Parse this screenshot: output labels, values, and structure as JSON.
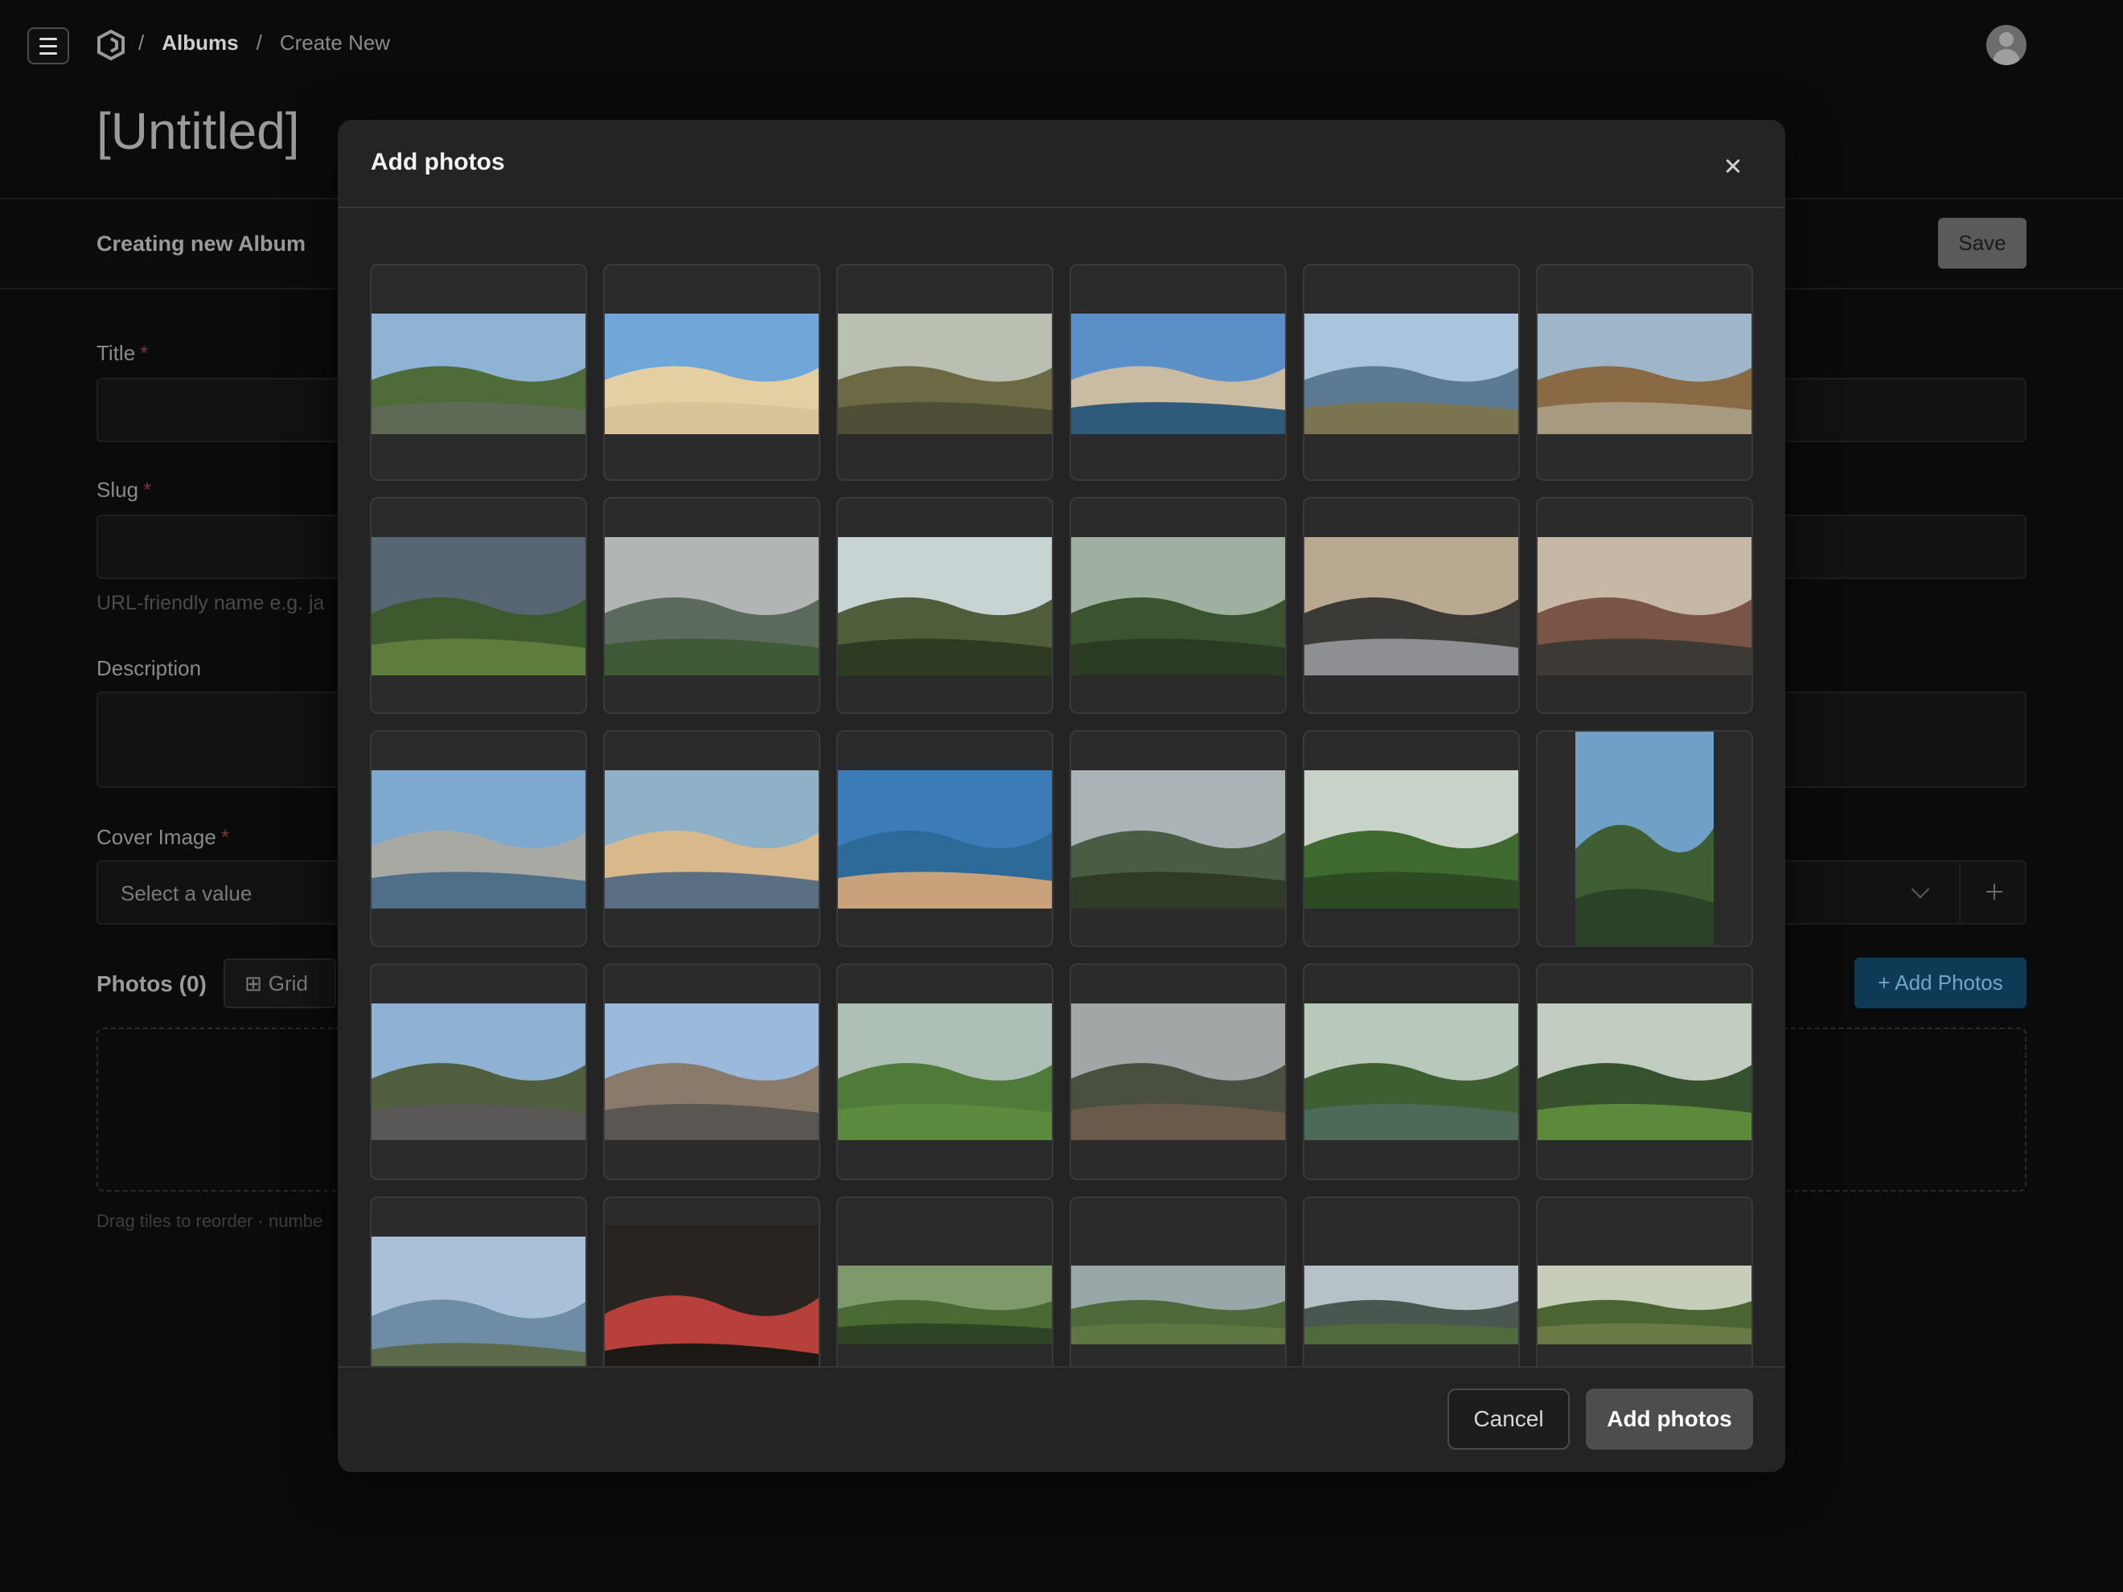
{
  "breadcrumb": {
    "sep": "/",
    "albums": "Albums",
    "current": "Create New"
  },
  "page": {
    "title": "[Untitled]",
    "mode_label": "Creating new Album",
    "save_label": "Save"
  },
  "form": {
    "title_label": "Title",
    "slug_label": "Slug",
    "slug_hint": "URL-friendly name e.g. ja",
    "description_label": "Description",
    "cover_label": "Cover Image",
    "cover_placeholder": "Select a value",
    "required_mark": "*",
    "photos_label": "Photos (0)",
    "grid_label": "Grid",
    "add_photos_label": "+ Add Photos",
    "drag_hint": "Drag tiles to reorder · numbe"
  },
  "modal": {
    "title": "Add photos",
    "cancel_label": "Cancel",
    "confirm_label": "Add photos",
    "photos": [
      {
        "name": "tree-lined-road",
        "sky": "#8fb3d4",
        "mid": "#4f6b3a",
        "ground": "#5e6a55",
        "layout": "wide"
      },
      {
        "name": "beach-4wd",
        "sky": "#6fa7d8",
        "mid": "#e3cfa1",
        "ground": "#d9c398",
        "layout": "wide"
      },
      {
        "name": "cliff-forest-view",
        "sky": "#b9c0b2",
        "mid": "#6b6a44",
        "ground": "#4d4e35",
        "layout": "wide"
      },
      {
        "name": "opera-house",
        "sky": "#5b8fc7",
        "mid": "#c9bca2",
        "ground": "#2f5a7a",
        "layout": "wide"
      },
      {
        "name": "harbour-rocks",
        "sky": "#a9c4dc",
        "mid": "#5c7a94",
        "ground": "#7a7450",
        "layout": "wide"
      },
      {
        "name": "beach-headland",
        "sky": "#9fb5c8",
        "mid": "#8a6a45",
        "ground": "#a79a80",
        "layout": "wide"
      },
      {
        "name": "green-valley",
        "sky": "#586674",
        "mid": "#3d5a2e",
        "ground": "#5e7c3b",
        "layout": "wide"
      },
      {
        "name": "cloudy-mountains",
        "sky": "#b1b5b4",
        "mid": "#5b6a5b",
        "ground": "#3f5a36",
        "layout": "wide"
      },
      {
        "name": "rock-peak-trees",
        "sky": "#c8d4d4",
        "mid": "#4f5d3b",
        "ground": "#2d3b22",
        "layout": "wide"
      },
      {
        "name": "forest-path",
        "sky": "#9fb0a0",
        "mid": "#3b5430",
        "ground": "#2b3a22",
        "layout": "wide"
      },
      {
        "name": "sunset-shore",
        "sky": "#b9a990",
        "mid": "#3c3a36",
        "ground": "#8d8f92",
        "layout": "wide"
      },
      {
        "name": "city-laneway",
        "sky": "#c7b8a5",
        "mid": "#7a5545",
        "ground": "#3d3a36",
        "layout": "wide"
      },
      {
        "name": "harbour-bridge",
        "sky": "#7fa8cf",
        "mid": "#a8a9a2",
        "ground": "#4f6f88",
        "layout": "wide"
      },
      {
        "name": "city-skyline-dusk",
        "sky": "#8fb1c8",
        "mid": "#d9b88b",
        "ground": "#5a6f82",
        "layout": "wide"
      },
      {
        "name": "blue-beach",
        "sky": "#3b7bb8",
        "mid": "#2e6a98",
        "ground": "#c8a27a",
        "layout": "wide"
      },
      {
        "name": "mountain-lookout",
        "sky": "#aab3b6",
        "mid": "#4a5c44",
        "ground": "#2f3b26",
        "layout": "wide"
      },
      {
        "name": "bush-canopy",
        "sky": "#c8d2c8",
        "mid": "#3f6a2e",
        "ground": "#2c4b22",
        "layout": "wide"
      },
      {
        "name": "rainforest-waterfall",
        "sky": "#6fa0c8",
        "mid": "#3f5e34",
        "ground": "#2b4228",
        "layout": "tall"
      },
      {
        "name": "roadside-stop",
        "sky": "#8fb1d2",
        "mid": "#4f5e3c",
        "ground": "#5a5856",
        "layout": "wide"
      },
      {
        "name": "heritage-pub",
        "sky": "#9ab9dc",
        "mid": "#8a7a6a",
        "ground": "#5a5652",
        "layout": "wide"
      },
      {
        "name": "cow-in-field",
        "sky": "#aebfb5",
        "mid": "#4f7a3a",
        "ground": "#5c8a3e",
        "layout": "wide"
      },
      {
        "name": "overcast-paddock",
        "sky": "#a2a6a6",
        "mid": "#4a5040",
        "ground": "#6a5a4a",
        "layout": "wide"
      },
      {
        "name": "creek-waterfall",
        "sky": "#b9c9b9",
        "mid": "#3e5f32",
        "ground": "#4b6a58",
        "layout": "wide"
      },
      {
        "name": "park-lawn-trees",
        "sky": "#c2ccc0",
        "mid": "#36522c",
        "ground": "#5c8a3a",
        "layout": "wide"
      },
      {
        "name": "marina-boats",
        "sky": "#a9c1d8",
        "mid": "#6e8ca6",
        "ground": "#5a6a4a",
        "layout": "wide"
      },
      {
        "name": "night-street-shop",
        "sky": "#2a2420",
        "mid": "#b8403a",
        "ground": "#1c1814",
        "layout": "wide"
      },
      {
        "name": "river-bend",
        "sky": "#7f9a6a",
        "mid": "#4a6a34",
        "ground": "#2f4424",
        "layout": "wide"
      },
      {
        "name": "farmland-panorama",
        "sky": "#9aa7a8",
        "mid": "#4f6a3a",
        "ground": "#5e7640",
        "layout": "wide"
      },
      {
        "name": "glasshouse-mountain",
        "sky": "#b7c2c6",
        "mid": "#4a5650",
        "ground": "#4f6a3c",
        "layout": "wide"
      },
      {
        "name": "bushland-track",
        "sky": "#c6cdb8",
        "mid": "#4b6532",
        "ground": "#6a7a44",
        "layout": "wide"
      }
    ]
  }
}
